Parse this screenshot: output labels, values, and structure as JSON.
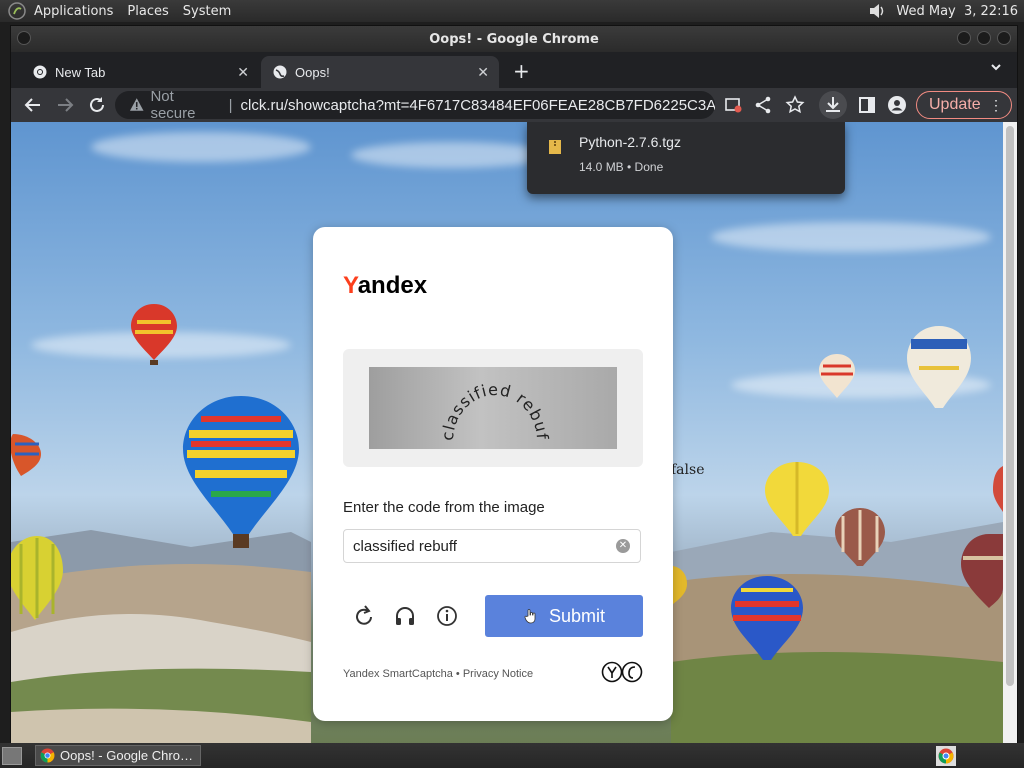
{
  "top_panel": {
    "menus": [
      "Applications",
      "Places",
      "System"
    ],
    "datetime": "Wed May  3, 22:16"
  },
  "window": {
    "title": "Oops! - Google Chrome"
  },
  "tabs": [
    {
      "label": "New Tab",
      "active": false
    },
    {
      "label": "Oops!",
      "active": true
    }
  ],
  "toolbar": {
    "security_label": "Not secure",
    "url": "clck.ru/showcaptcha?mt=4F6717C83484EF06FEAE28CB7FD6225C3A…",
    "update_label": "Update"
  },
  "download": {
    "filename": "Python-2.7.6.tgz",
    "status": "14.0 MB • Done"
  },
  "page": {
    "stray_text": "false"
  },
  "captcha": {
    "brand_first": "Y",
    "brand_rest": "andex",
    "image_text": "classified rebuff",
    "instruction": "Enter the code from the image",
    "input_value": "classified rebuff",
    "submit_label": "Submit",
    "footer": "Yandex SmartCaptcha • Privacy Notice"
  },
  "taskbar": {
    "task_label": "Oops! - Google Chro…"
  },
  "colors": {
    "submit_bg": "#5a82dc",
    "yandex_red": "#fc3f1d",
    "update_border": "#f28b82"
  }
}
